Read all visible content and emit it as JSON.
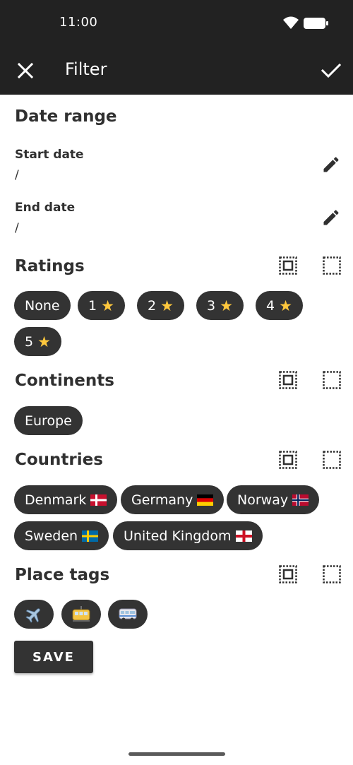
{
  "status_bar": {
    "time": "11:00"
  },
  "app_bar": {
    "title": "Filter",
    "close_icon": "close-icon",
    "confirm_icon": "check-icon"
  },
  "date_range": {
    "title": "Date range",
    "start_label": "Start date",
    "start_value": "/",
    "end_label": "End date",
    "end_value": "/"
  },
  "ratings": {
    "title": "Ratings",
    "chips": [
      "None",
      "1",
      "2",
      "3",
      "4",
      "5"
    ]
  },
  "continents": {
    "title": "Continents",
    "chips": [
      "Europe"
    ]
  },
  "countries": {
    "title": "Countries",
    "chips": [
      "Denmark",
      "Germany",
      "Norway",
      "Sweden",
      "United Kingdom"
    ]
  },
  "place_tags": {
    "title": "Place tags",
    "chips": [
      "airplane-icon",
      "tram-icon",
      "bus-icon"
    ]
  },
  "save_label": "SAVE",
  "colors": {
    "bar": "#222222",
    "chip": "#333333",
    "star": "#ffc83d"
  }
}
